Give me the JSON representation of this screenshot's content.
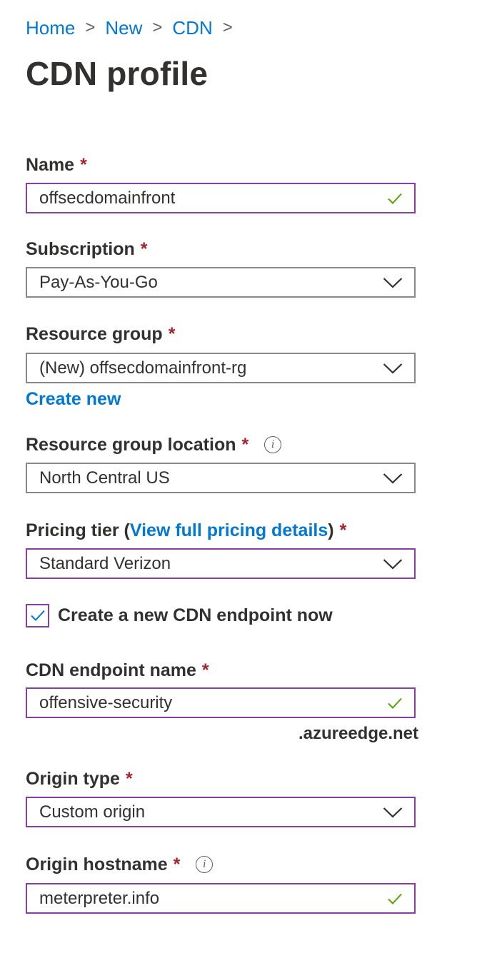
{
  "breadcrumb": {
    "items": [
      "Home",
      "New",
      "CDN"
    ],
    "separator": ">"
  },
  "page_title": "CDN profile",
  "name_field": {
    "label": "Name",
    "required": "*",
    "value": "offsecdomainfront",
    "valid": true
  },
  "subscription": {
    "label": "Subscription",
    "required": "*",
    "value": "Pay-As-You-Go"
  },
  "resource_group": {
    "label": "Resource group",
    "required": "*",
    "value": "(New) offsecdomainfront-rg",
    "create_new_label": "Create new"
  },
  "resource_group_location": {
    "label": "Resource group location",
    "required": "*",
    "info_icon": "i",
    "value": "North Central US"
  },
  "pricing_tier": {
    "label_prefix": "Pricing tier (",
    "link_label": "View full pricing details",
    "label_suffix": ")",
    "required": "*",
    "value": "Standard Verizon"
  },
  "create_endpoint": {
    "label": "Create a new CDN endpoint now",
    "checked": true
  },
  "endpoint_name": {
    "label": "CDN endpoint name",
    "required": "*",
    "value": "offensive-security",
    "suffix": ".azureedge.net",
    "valid": true
  },
  "origin_type": {
    "label": "Origin type",
    "required": "*",
    "value": "Custom origin"
  },
  "origin_hostname": {
    "label": "Origin hostname",
    "required": "*",
    "info_icon": "i",
    "value": "meterpreter.info",
    "valid": true
  },
  "colors": {
    "link": "#0078d4",
    "required": "#a4262c",
    "focus_border": "#8a3ea4",
    "valid_check": "#57a300",
    "text": "#323130"
  }
}
